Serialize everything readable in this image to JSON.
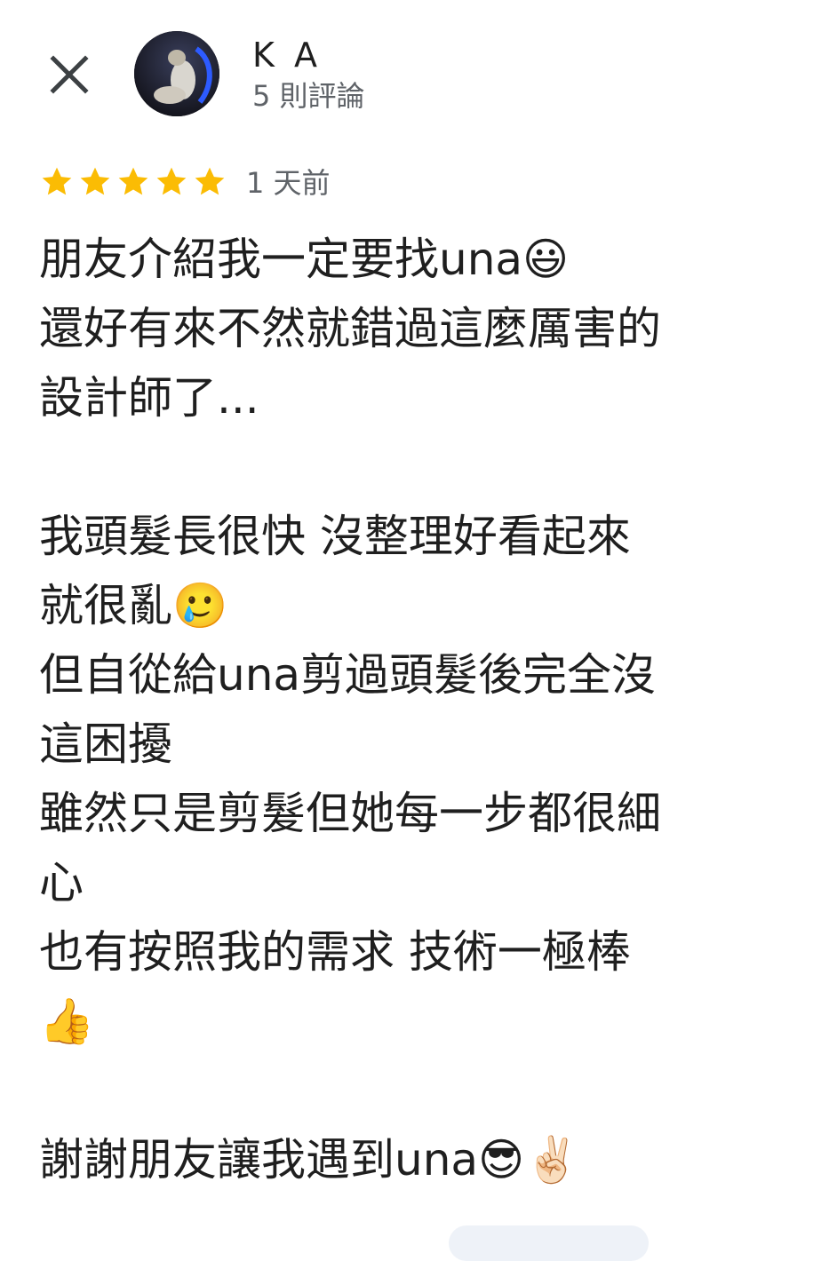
{
  "header": {
    "reviewer_name": "K A",
    "review_count": "5 則評論"
  },
  "rating": {
    "value": 5,
    "max": 5,
    "star_color": "#fbbc04"
  },
  "review": {
    "time": "1 天前",
    "lines": [
      "朋友介紹我一定要找una😃",
      "還好有來不然就錯過這麼厲害的",
      "設計師了...",
      "",
      "我頭髮長很快 沒整理好看起來",
      "就很亂🥲",
      "但自從給una剪過頭髮後完全沒",
      "這困擾",
      "雖然只是剪髮但她每一步都很細",
      "心",
      "也有按照我的需求 技術一極棒",
      "👍",
      "",
      "謝謝朋友讓我遇到una😎✌🏻"
    ]
  },
  "icons": {
    "close": "close-icon",
    "star": "star-icon",
    "avatar": "avatar-image"
  }
}
